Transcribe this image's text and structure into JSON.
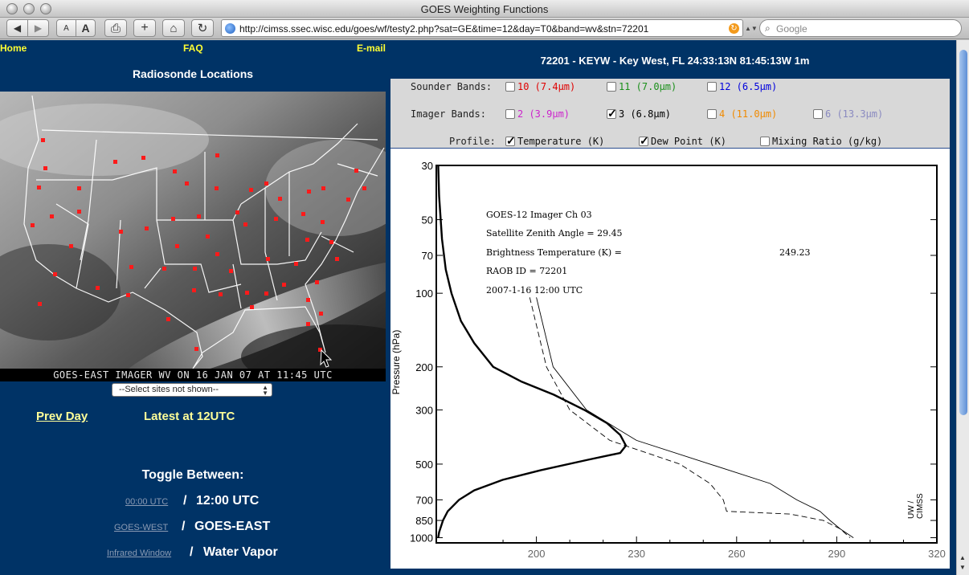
{
  "window": {
    "title": "GOES Weighting Functions",
    "url": "http://cimss.ssec.wisc.edu/goes/wf/testy2.php?sat=GE&time=12&day=T0&band=wv&stn=72201",
    "search_placeholder": "Google"
  },
  "toolbar": {
    "back_label": "◀",
    "forward_label": "▶",
    "text_smaller": "A",
    "text_bigger": "A",
    "print_label": "⎙",
    "add_label": "+",
    "home_label": "⌂",
    "reload_label": "↻"
  },
  "nav": {
    "home": "Home",
    "faq": "FAQ",
    "email": "E-mail"
  },
  "left": {
    "title": "Radiosonde Locations",
    "map_caption": "GOES-EAST IMAGER WV ON 16 JAN 07 AT 11:45 UTC",
    "select_value": "--Select sites not shown--",
    "prev_day": "Prev Day",
    "latest": "Latest at 12UTC",
    "toggle_title": "Toggle Between:",
    "toggle1_link": "00:00 UTC",
    "toggle1_current": "12:00 UTC",
    "toggle2_link": "GOES-WEST",
    "toggle2_current": "GOES-EAST",
    "toggle3_link": "Infrared Window",
    "toggle3_current": "Water Vapor",
    "slash": "/"
  },
  "right": {
    "station_title": "72201 - KEYW - Key West, FL 24:33:13N 81:45:13W 1m",
    "sounder_label": "Sounder  Bands:",
    "imager_label": "Imager  Bands:",
    "profile_label": "Profile:",
    "sounder_bands": [
      {
        "text": "10 (7.4µm)",
        "color": "#e00000",
        "checked": false
      },
      {
        "text": "11 (7.0µm)",
        "color": "#1a8f1a",
        "checked": false
      },
      {
        "text": "12 (6.5µm)",
        "color": "#0000dd",
        "checked": false
      }
    ],
    "imager_bands": [
      {
        "text": "2 (3.9µm)",
        "color": "#cc22cc",
        "checked": false
      },
      {
        "text": "3 (6.8µm)",
        "color": "#000000",
        "checked": true
      },
      {
        "text": "4 (11.0µm)",
        "color": "#f08a00",
        "checked": false
      },
      {
        "text": "6 (13.3µm)",
        "color": "#8a8ac0",
        "checked": false
      }
    ],
    "profiles": [
      {
        "text": "Temperature (K)",
        "checked": true
      },
      {
        "text": "Dew Point (K)",
        "checked": true
      },
      {
        "text": "Mixing Ratio (g/kg)",
        "checked": false
      }
    ]
  },
  "chart_data": {
    "type": "line",
    "ylabel": "Pressure (hPa)",
    "y_scale": "log",
    "y_inverted": true,
    "ylim": [
      30,
      1050
    ],
    "yticks": [
      30,
      50,
      70,
      100,
      200,
      300,
      500,
      700,
      850,
      1000
    ],
    "xlim": [
      170,
      320
    ],
    "xticks": [
      200,
      230,
      260,
      290,
      320
    ],
    "annotations": [
      "GOES-12 Imager  Ch     03",
      "Satellite Zenith Angle = 29.45",
      "Brightness Temperature (K) =",
      "RAOB ID = 72201",
      "2007-1-16 12:00 UTC"
    ],
    "brightness_temperature": "249.23",
    "credit": "UW / CIMSS",
    "series": [
      {
        "name": "Weighting function",
        "style": "thick-solid",
        "points": [
          [
            30,
            0.01
          ],
          [
            40,
            0.015
          ],
          [
            60,
            0.03
          ],
          [
            80,
            0.05
          ],
          [
            100,
            0.08
          ],
          [
            130,
            0.13
          ],
          [
            160,
            0.2
          ],
          [
            200,
            0.3
          ],
          [
            230,
            0.45
          ],
          [
            260,
            0.62
          ],
          [
            300,
            0.78
          ],
          [
            340,
            0.9
          ],
          [
            380,
            0.97
          ],
          [
            420,
            1.0
          ],
          [
            450,
            0.97
          ],
          [
            480,
            0.8
          ],
          [
            530,
            0.55
          ],
          [
            580,
            0.35
          ],
          [
            640,
            0.2
          ],
          [
            700,
            0.12
          ],
          [
            780,
            0.06
          ],
          [
            850,
            0.035
          ],
          [
            950,
            0.015
          ],
          [
            1000,
            0.01
          ]
        ]
      },
      {
        "name": "Temperature (K)",
        "style": "solid",
        "points": [
          [
            200,
            104
          ],
          [
            205,
            200
          ],
          [
            215,
            300
          ],
          [
            230,
            400
          ],
          [
            252,
            500
          ],
          [
            270,
            600
          ],
          [
            278,
            700
          ],
          [
            285,
            780
          ],
          [
            288,
            850
          ],
          [
            291,
            920
          ],
          [
            295,
            1000
          ]
        ]
      },
      {
        "name": "Dew Point (K)",
        "style": "dashed",
        "points": [
          [
            198,
            104
          ],
          [
            203,
            200
          ],
          [
            210,
            300
          ],
          [
            222,
            400
          ],
          [
            243,
            500
          ],
          [
            252,
            600
          ],
          [
            256,
            700
          ],
          [
            257,
            780
          ],
          [
            276,
            800
          ],
          [
            286,
            850
          ],
          [
            291,
            920
          ],
          [
            294,
            1000
          ]
        ]
      }
    ]
  }
}
